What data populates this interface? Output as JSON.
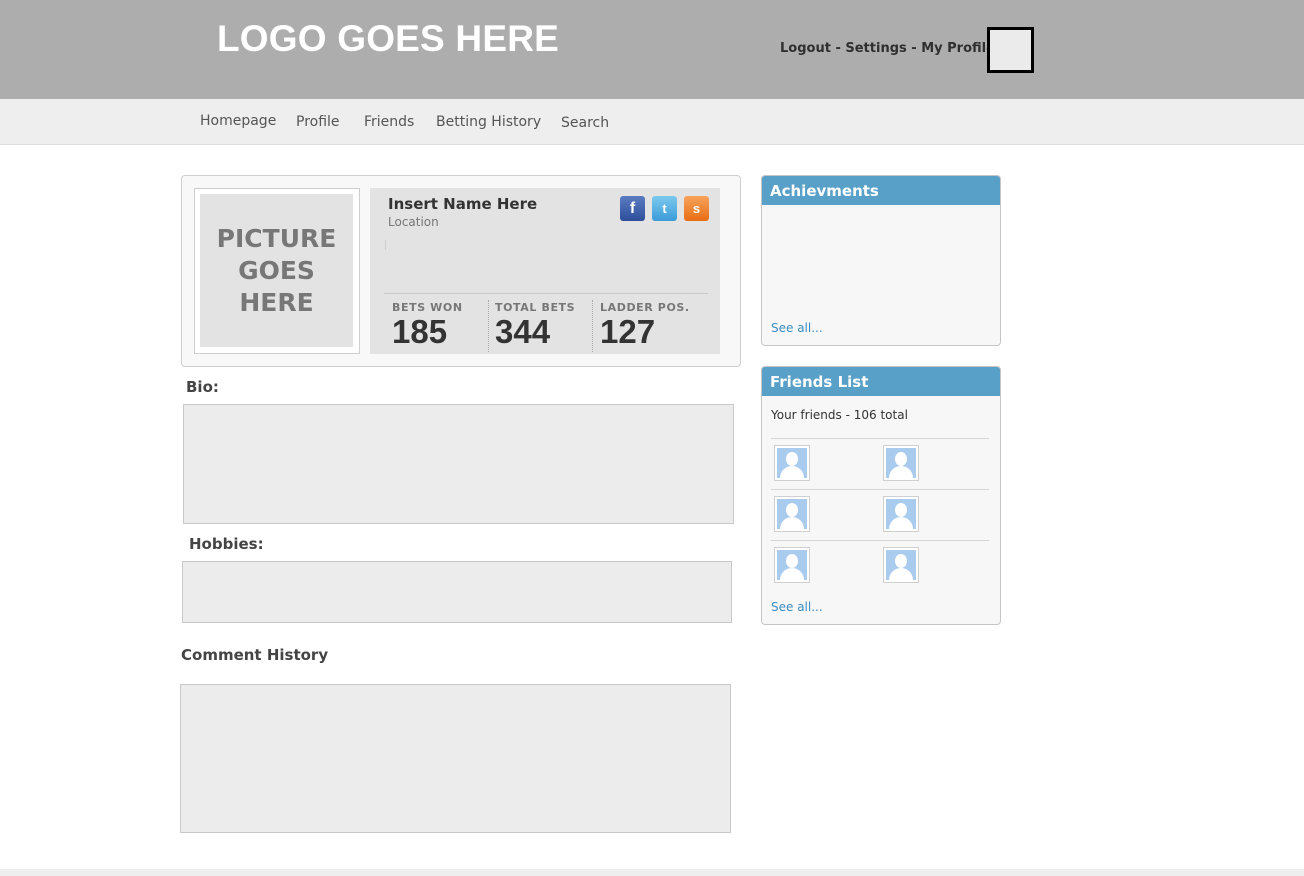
{
  "header": {
    "logo": "LOGO GOES HERE",
    "links": [
      "Logout",
      "Settings",
      "My Profile"
    ],
    "separator": " - "
  },
  "nav": {
    "items": [
      "Homepage",
      "Profile",
      "Friends",
      "Betting History",
      "Search"
    ]
  },
  "profile": {
    "picture_text": "PICTURE\nGOES\nHERE",
    "name": "Insert Name Here",
    "location": "Location",
    "social": [
      "f",
      "t",
      "s"
    ],
    "stats": [
      {
        "label": "BETS WON",
        "value": "185"
      },
      {
        "label": "TOTAL BETS",
        "value": "344"
      },
      {
        "label": "LADDER POS.",
        "value": "127"
      }
    ]
  },
  "sections": {
    "bio": "Bio:",
    "hobbies": "Hobbies:",
    "comment_history": "Comment History"
  },
  "achievements": {
    "title": "Achievments",
    "see_all": "See all..."
  },
  "friends": {
    "title": "Friends List",
    "count_text": "Your friends - 106 total",
    "see_all": "See all..."
  },
  "colors": {
    "header_bg": "#adadad",
    "nav_bg": "#eeeeee",
    "panel_head": "#58a0c7",
    "link": "#3c8dc2"
  }
}
